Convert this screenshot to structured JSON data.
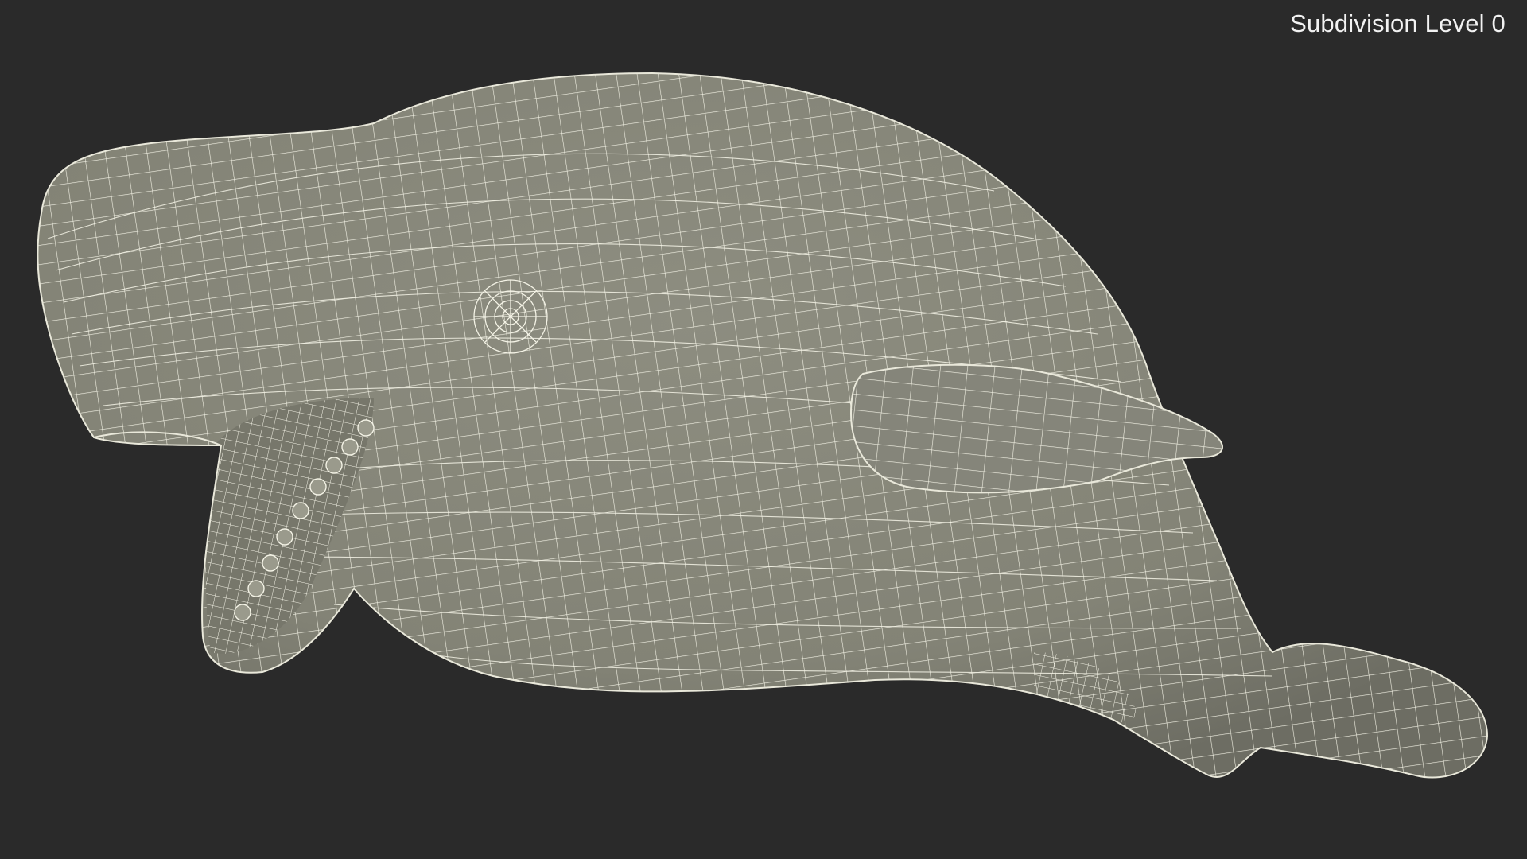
{
  "viewport": {
    "label": "Subdivision Level 0",
    "background_color": "#2a2a2a",
    "mesh_fill_color": "#8a8a7c",
    "wire_color": "#f4f3e6"
  },
  "model": {
    "name": "",
    "icon": "whale-wireframe-mesh"
  }
}
